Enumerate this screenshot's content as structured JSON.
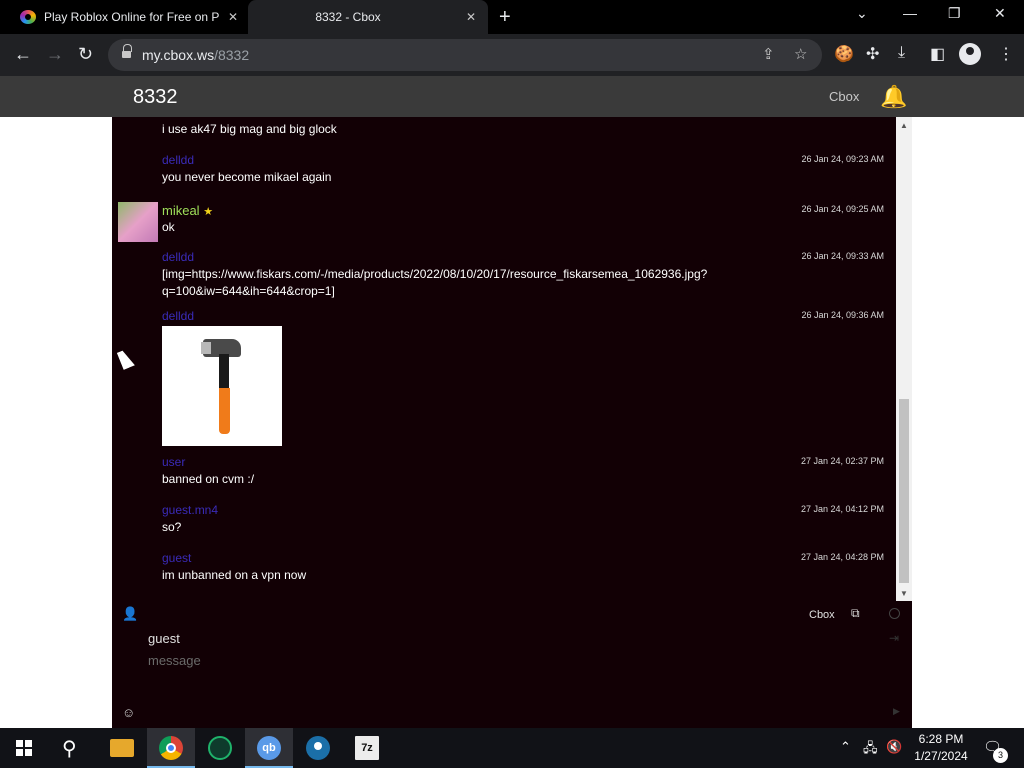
{
  "browser": {
    "tabs": [
      {
        "title": "Play Roblox Online for Free on P"
      },
      {
        "title": "8332 - Cbox"
      }
    ],
    "address": {
      "host": "my.cbox.ws",
      "path": "/8332"
    }
  },
  "page": {
    "title": "8332",
    "cbox_link": "Cbox"
  },
  "messages": [
    {
      "name": "",
      "time": "",
      "text": "i use ak47 big mag and big glock"
    },
    {
      "name": "delldd",
      "time": "26 Jan 24, 09:23 AM",
      "text": "you never become mikael again"
    },
    {
      "name": "mikeal",
      "time": "26 Jan 24, 09:25 AM",
      "text": "ok"
    },
    {
      "name": "delldd",
      "time": "26 Jan 24, 09:33 AM",
      "text": "[img=https://www.fiskars.com/-/media/products/2022/08/10/20/17/resource_fiskarsemea_1062936.jpg?",
      "text2": "q=100&iw=644&ih=644&crop=1]"
    },
    {
      "name": "delldd",
      "time": "26 Jan 24, 09:36 AM",
      "text": ""
    },
    {
      "name": "user",
      "time": "27 Jan 24, 02:37 PM",
      "text": "banned on cvm :/"
    },
    {
      "name": "guest.mn4",
      "time": "27 Jan 24, 04:12 PM",
      "text": "so?"
    },
    {
      "name": "guest",
      "time": "27 Jan 24, 04:28 PM",
      "text": "im unbanned on a vpn now"
    }
  ],
  "input": {
    "cbox_label": "Cbox",
    "name_value": "guest",
    "message_placeholder": "message"
  },
  "taskbar": {
    "time": "6:28 PM",
    "date": "1/27/2024",
    "notification_count": "3",
    "apps": [
      "file-explorer",
      "chrome",
      "gx-app",
      "qbittorrent",
      "steam",
      "7zip"
    ],
    "qb_label": "qb",
    "sevenzip_label": "7z"
  }
}
